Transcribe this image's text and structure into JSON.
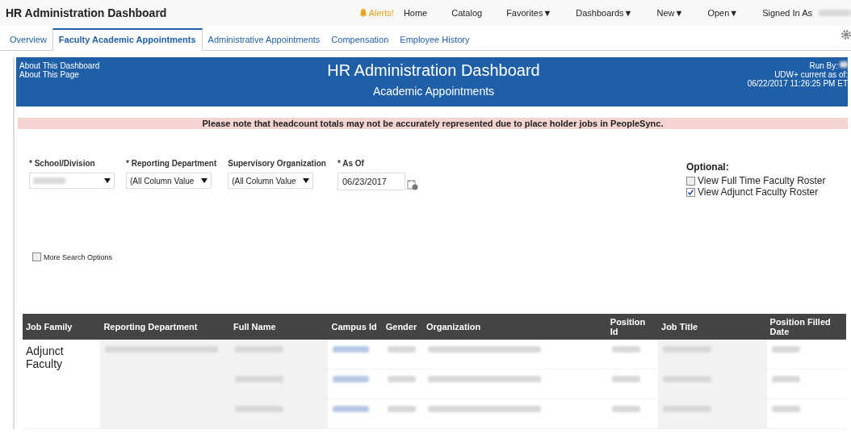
{
  "header": {
    "title": "HR Administration Dashboard",
    "alerts": "Alerts!",
    "nav": [
      {
        "label": "Home",
        "menu": false
      },
      {
        "label": "Catalog",
        "menu": false
      },
      {
        "label": "Favorites",
        "menu": true
      },
      {
        "label": "Dashboards",
        "menu": true
      },
      {
        "label": "New",
        "menu": true
      },
      {
        "label": "Open",
        "menu": true
      }
    ],
    "signed_in_label": "Signed In As",
    "user_redacted": true,
    "menu_caret": "▼"
  },
  "tabs": [
    {
      "label": "Overview",
      "selected": false
    },
    {
      "label": "Faculty Academic Appointments",
      "selected": true
    },
    {
      "label": "Administrative Appointments",
      "selected": false
    },
    {
      "label": "Compensation",
      "selected": false
    },
    {
      "label": "Employee History",
      "selected": false
    }
  ],
  "banner": {
    "links": [
      "About This Dashboard",
      "About This Page"
    ],
    "title": "HR Administration Dashboard",
    "subtitle": "Academic Appointments",
    "run_by": "Run By:",
    "run_by_redacted": true,
    "current_as_of": "UDW+ current as of:",
    "timestamp": "06/22/2017 11:26:25 PM ET"
  },
  "notice": "Please note that headcount totals may not be accurately represented due to place holder jobs in PeopleSync.",
  "filters": [
    {
      "kind": "dropdown",
      "label": "* School/Division",
      "value_redacted": true
    },
    {
      "kind": "dropdown",
      "label": "* Reporting Department",
      "value": "(All Column Value"
    },
    {
      "kind": "dropdown",
      "label": "Supervisory Organization",
      "value": "(All Column Value"
    },
    {
      "kind": "date",
      "label": "* As Of",
      "value": "06/23/2017"
    }
  ],
  "optional": {
    "title": "Optional:",
    "options": [
      {
        "label": "View Full Time Faculty Roster",
        "checked": false
      },
      {
        "label": "View Adjunct Faculty Roster",
        "checked": true
      }
    ]
  },
  "more_search_options": {
    "label": "More Search Options",
    "checked": false
  },
  "table": {
    "columns": [
      "Job Family",
      "Reporting Department",
      "Full Name",
      "Campus Id",
      "Gender",
      "Organization",
      "Position Id",
      "Job Title",
      "Position Filled Date"
    ],
    "group": "Adjunct Faculty",
    "department_redacted": true,
    "rows": [
      {
        "redacted": true
      },
      {
        "redacted": true
      },
      {
        "redacted": true
      }
    ]
  }
}
